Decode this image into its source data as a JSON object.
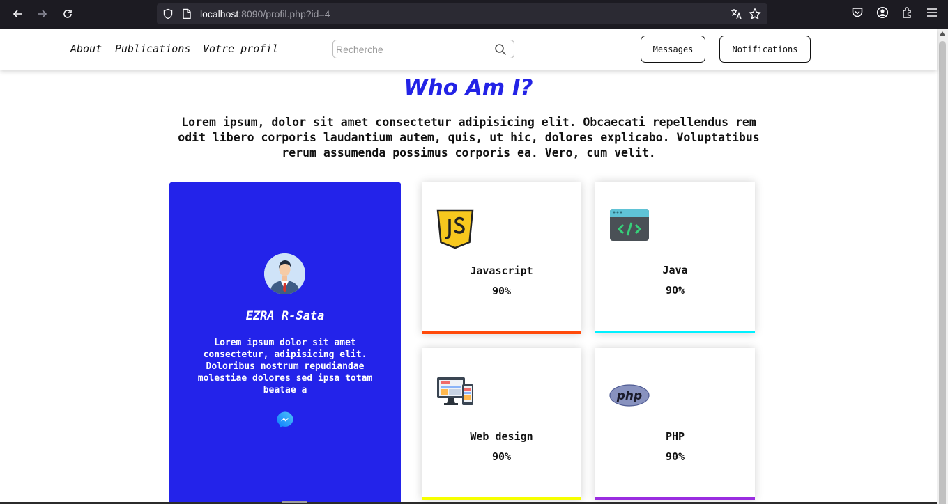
{
  "browser": {
    "url_host": "localhost",
    "url_rest": ":8090/profil.php?id=4"
  },
  "nav": {
    "links": [
      "About",
      "Publications",
      "Votre profil"
    ],
    "search_placeholder": "Recherche",
    "messages_label": "Messages",
    "notifications_label": "Notifications"
  },
  "hero": {
    "title": "Who Am I?",
    "intro": "Lorem ipsum, dolor sit amet consectetur adipisicing elit. Obcaecati repellendus rem odit libero corporis laudantium autem, quis, ut hic, dolores explicabo. Voluptatibus rerum assumenda possimus corporis ea. Vero, cum velit."
  },
  "profile": {
    "name": "EZRA R-Sata",
    "bio": "Lorem ipsum dolor sit amet consectetur, adipisicing elit. Doloribus nostrum repudiandae molestiae dolores sed ipsa totam beatae a",
    "card_color": "#2323ea",
    "contact_icon": "messenger-icon"
  },
  "skills": [
    {
      "name": "Javascript",
      "percent": "90%",
      "icon": "javascript-icon",
      "color": "#ff4a0a"
    },
    {
      "name": "Java",
      "percent": "90%",
      "icon": "code-window-icon",
      "color": "#00f0ff"
    },
    {
      "name": "Web design",
      "percent": "90%",
      "icon": "web-design-icon",
      "color": "#f6ff00"
    },
    {
      "name": "PHP",
      "percent": "90%",
      "icon": "php-icon",
      "color": "#9a2de0"
    }
  ],
  "colors": {
    "accent": "#2323e6"
  }
}
